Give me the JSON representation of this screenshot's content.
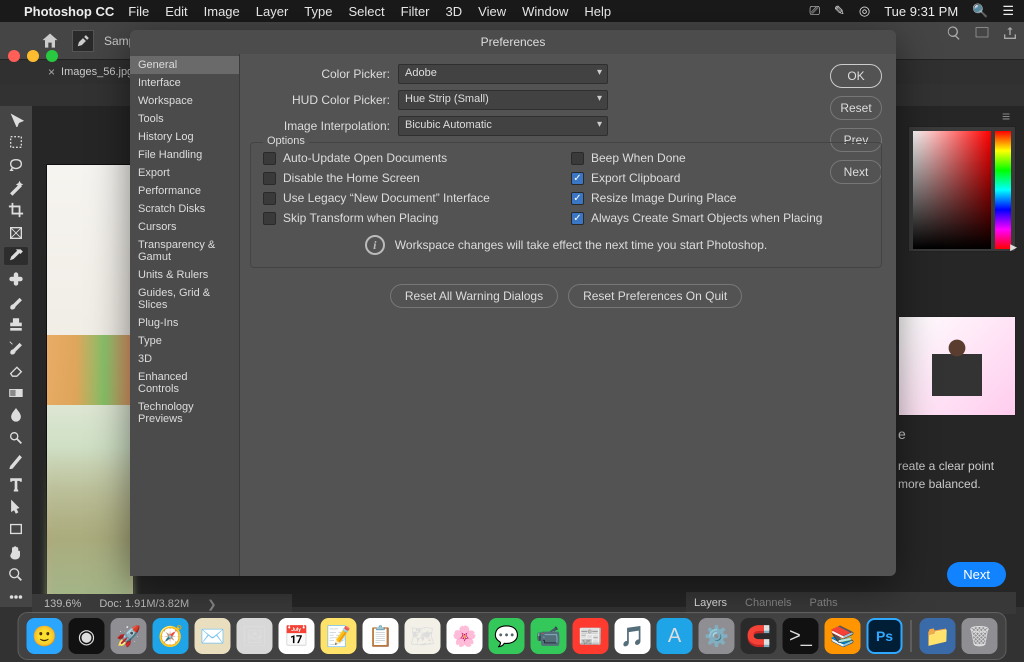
{
  "menubar": {
    "app": "Photoshop CC",
    "items": [
      "File",
      "Edit",
      "Image",
      "Layer",
      "Type",
      "Select",
      "Filter",
      "3D",
      "View",
      "Window",
      "Help"
    ],
    "clock": "Tue 9:31 PM"
  },
  "options_bar": {
    "sample_label": "Sample"
  },
  "doc_tab": {
    "name": "Images_56.jpg"
  },
  "status": {
    "zoom": "139.6%",
    "docinfo": "Doc: 1.91M/3.82M"
  },
  "layers_tabs": [
    "Layers",
    "Channels",
    "Paths"
  ],
  "lesson": {
    "title_frag": "e",
    "text": "reate a clear point more balanced.",
    "next": "Next"
  },
  "prefs": {
    "title": "Preferences",
    "sidebar": [
      "General",
      "Interface",
      "Workspace",
      "Tools",
      "History Log",
      "File Handling",
      "Export",
      "Performance",
      "Scratch Disks",
      "Cursors",
      "Transparency & Gamut",
      "Units & Rulers",
      "Guides, Grid & Slices",
      "Plug-Ins",
      "Type",
      "3D",
      "Enhanced Controls",
      "Technology Previews"
    ],
    "selected_sidebar": "General",
    "fields": {
      "color_picker": {
        "label": "Color Picker:",
        "value": "Adobe"
      },
      "hud": {
        "label": "HUD Color Picker:",
        "value": "Hue Strip (Small)"
      },
      "interp": {
        "label": "Image Interpolation:",
        "value": "Bicubic Automatic"
      }
    },
    "options_legend": "Options",
    "checks": {
      "auto_update": {
        "label": "Auto-Update Open Documents",
        "on": false
      },
      "beep": {
        "label": "Beep When Done",
        "on": false
      },
      "disable_home": {
        "label": "Disable the Home Screen",
        "on": false
      },
      "export_clip": {
        "label": "Export Clipboard",
        "on": true
      },
      "legacy_newdoc": {
        "label": "Use Legacy “New Document” Interface",
        "on": false
      },
      "resize_place": {
        "label": "Resize Image During Place",
        "on": true
      },
      "skip_transform": {
        "label": "Skip Transform when Placing",
        "on": false
      },
      "smart_objs": {
        "label": "Always Create Smart Objects when Placing",
        "on": true
      }
    },
    "info_msg": "Workspace changes will take effect the next time you start Photoshop.",
    "reset_warnings": "Reset All Warning Dialogs",
    "reset_on_quit": "Reset Preferences On Quit",
    "btn_ok": "OK",
    "btn_reset": "Reset",
    "btn_prev": "Prev",
    "btn_next": "Next"
  },
  "dock_items": [
    {
      "name": "finder",
      "bg": "#2aa6ff",
      "glyph": "🙂"
    },
    {
      "name": "siri",
      "bg": "#111",
      "glyph": "◉"
    },
    {
      "name": "launchpad",
      "bg": "#8e8e93",
      "glyph": "🚀"
    },
    {
      "name": "safari",
      "bg": "#1fa4e8",
      "glyph": "🧭"
    },
    {
      "name": "mail",
      "bg": "#e9dfbf",
      "glyph": "✉️"
    },
    {
      "name": "photoshop-doc",
      "bg": "#d8d8d8",
      "glyph": "🖼"
    },
    {
      "name": "calendar",
      "bg": "#fff",
      "glyph": "📅"
    },
    {
      "name": "notes",
      "bg": "#ffe26a",
      "glyph": "📝"
    },
    {
      "name": "reminders",
      "bg": "#fff",
      "glyph": "📋"
    },
    {
      "name": "maps",
      "bg": "#f3f0e7",
      "glyph": "🗺"
    },
    {
      "name": "photos",
      "bg": "#fff",
      "glyph": "🌸"
    },
    {
      "name": "messages",
      "bg": "#34c759",
      "glyph": "💬"
    },
    {
      "name": "facetime",
      "bg": "#34c759",
      "glyph": "📹"
    },
    {
      "name": "news",
      "bg": "#ff3b30",
      "glyph": "📰"
    },
    {
      "name": "music",
      "bg": "#fff",
      "glyph": "🎵"
    },
    {
      "name": "appstore",
      "bg": "#1fa4e8",
      "glyph": "A"
    },
    {
      "name": "settings",
      "bg": "#8e8e93",
      "glyph": "⚙️"
    },
    {
      "name": "magnet",
      "bg": "#2a2a2a",
      "glyph": "🧲"
    },
    {
      "name": "terminal",
      "bg": "#111",
      "glyph": ">_"
    },
    {
      "name": "books",
      "bg": "#ff9500",
      "glyph": "📚"
    },
    {
      "name": "photoshop",
      "bg": "#001e36",
      "glyph": "Ps"
    }
  ],
  "dock_right": [
    {
      "name": "folder",
      "bg": "#3a6aa8",
      "glyph": "📁"
    },
    {
      "name": "trash",
      "bg": "#8e8e93",
      "glyph": "🗑"
    }
  ],
  "tool_names": [
    "move",
    "marquee",
    "lasso",
    "wand",
    "crop",
    "frame",
    "eyedropper",
    "heal",
    "brush",
    "stamp",
    "history-brush",
    "eraser",
    "gradient",
    "blur",
    "dodge",
    "pen",
    "type",
    "path-select",
    "rectangle",
    "hand",
    "zoom",
    "more"
  ]
}
